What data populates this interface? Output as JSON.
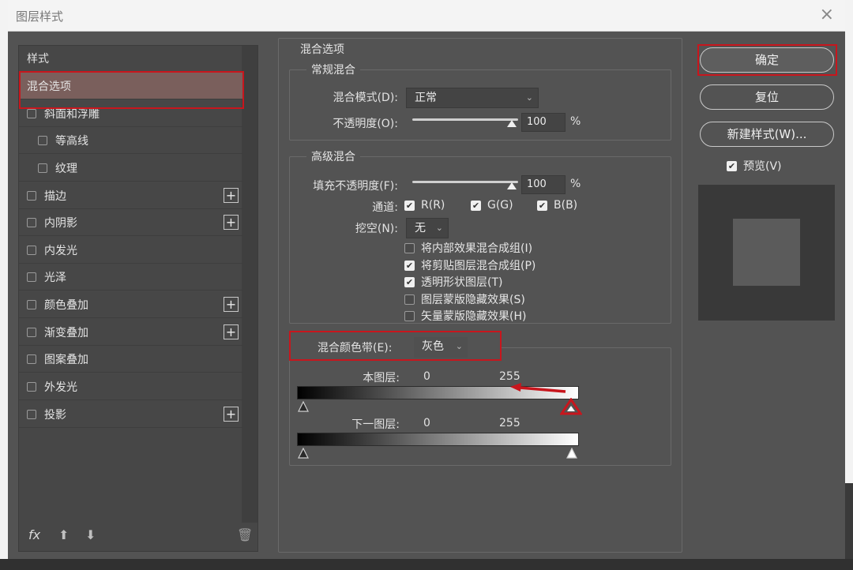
{
  "window": {
    "title": "图层样式",
    "close": "×"
  },
  "left": {
    "header": "样式",
    "items": [
      {
        "label": "混合选项",
        "checkbox": false,
        "plus": false,
        "active": true
      },
      {
        "label": "斜面和浮雕",
        "checkbox": true,
        "plus": false
      },
      {
        "label": "等高线",
        "checkbox": true,
        "plus": false,
        "indent": true
      },
      {
        "label": "纹理",
        "checkbox": true,
        "plus": false,
        "indent": true
      },
      {
        "label": "描边",
        "checkbox": true,
        "plus": true
      },
      {
        "label": "内阴影",
        "checkbox": true,
        "plus": true
      },
      {
        "label": "内发光",
        "checkbox": true,
        "plus": false
      },
      {
        "label": "光泽",
        "checkbox": true,
        "plus": false
      },
      {
        "label": "颜色叠加",
        "checkbox": true,
        "plus": true
      },
      {
        "label": "渐变叠加",
        "checkbox": true,
        "plus": true
      },
      {
        "label": "图案叠加",
        "checkbox": true,
        "plus": false
      },
      {
        "label": "外发光",
        "checkbox": true,
        "plus": false
      },
      {
        "label": "投影",
        "checkbox": true,
        "plus": true
      }
    ],
    "plus_symbol": "+",
    "footer": {
      "fx": "fx",
      "up": "⬆",
      "down": "⬇",
      "trash": "🗑"
    }
  },
  "blend": {
    "title": "混合选项",
    "general": {
      "title": "常规混合",
      "mode_label": "混合模式(D):",
      "mode_value": "正常",
      "opacity_label": "不透明度(O):",
      "opacity_value": "100",
      "percent": "%"
    },
    "advanced": {
      "title": "高级混合",
      "fill_label": "填充不透明度(F):",
      "fill_value": "100",
      "percent": "%",
      "channels_label": "通道:",
      "channels": [
        "R(R)",
        "G(G)",
        "B(B)"
      ],
      "knockout_label": "挖空(N):",
      "knockout_value": "无",
      "options": [
        {
          "label": "将内部效果混合成组(I)",
          "checked": false
        },
        {
          "label": "将剪贴图层混合成组(P)",
          "checked": true
        },
        {
          "label": "透明形状图层(T)",
          "checked": true
        },
        {
          "label": "图层蒙版隐藏效果(S)",
          "checked": false
        },
        {
          "label": "矢量蒙版隐藏效果(H)",
          "checked": false
        }
      ]
    },
    "blend_if": {
      "label": "混合颜色带(E):",
      "value": "灰色",
      "this_layer_label": "本图层:",
      "this_low": "0",
      "this_high": "255",
      "under_layer_label": "下一图层:",
      "under_low": "0",
      "under_high": "255"
    }
  },
  "buttons": {
    "ok": "确定",
    "reset": "复位",
    "new_style": "新建样式(W)...",
    "preview_label": "预览(V)",
    "check": "✔"
  },
  "caret": "⌄",
  "highlight_color": "#c8161d"
}
